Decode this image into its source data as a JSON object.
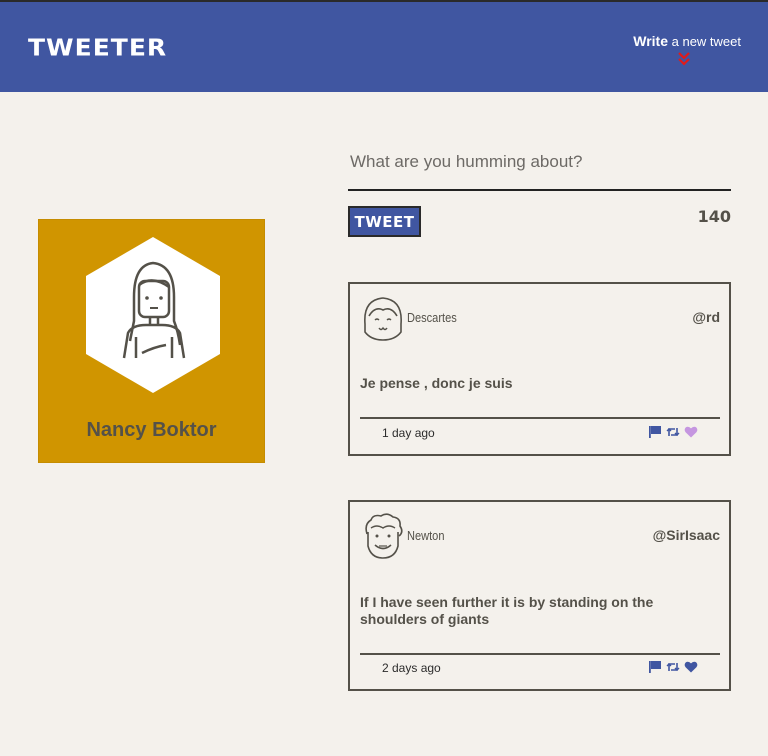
{
  "header": {
    "logo": "TWEETER",
    "compose_link_bold": "Write",
    "compose_link_rest": "a new tweet"
  },
  "profile": {
    "name": "Nancy Boktor",
    "avatar_icon": "woman-avatar-icon"
  },
  "composer": {
    "placeholder": "What are you humming about?",
    "value": "",
    "button_label": "TWEET",
    "char_counter": "140"
  },
  "tweets": [
    {
      "name": "Descartes",
      "handle": "@rd",
      "body": "Je pense , donc je suis",
      "time": "1 day ago",
      "like_color": "#c596e0"
    },
    {
      "name": "Newton",
      "handle": "@SirIsaac",
      "body": "If I have seen further it is by standing on the shoulders of giants",
      "time": "2 days ago",
      "like_color": "#4056a1"
    }
  ],
  "colors": {
    "header_bg": "#4056a1",
    "page_bg": "#f4f1ec",
    "profile_bg": "#d09500",
    "chevron": "#e01b1b",
    "text": "#545149"
  }
}
